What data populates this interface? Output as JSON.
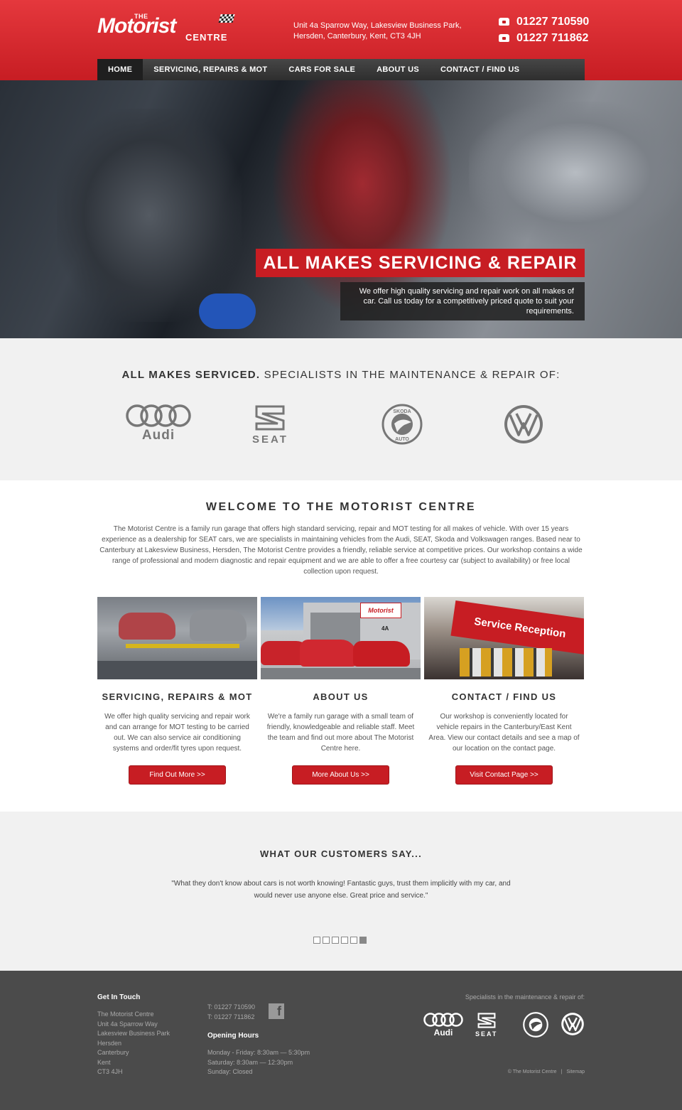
{
  "header": {
    "logo_the": "THE",
    "logo_main": "Motorist",
    "logo_centre": "CENTRE",
    "address_line1": "Unit 4a Sparrow Way, Lakesview Business Park,",
    "address_line2": "Hersden, Canterbury, Kent, CT3 4JH",
    "phone1": "01227 710590",
    "phone2": "01227 711862"
  },
  "nav": {
    "items": [
      "HOME",
      "SERVICING, REPAIRS & MOT",
      "CARS FOR SALE",
      "ABOUT US",
      "CONTACT / FIND US"
    ]
  },
  "hero": {
    "title": "ALL MAKES SERVICING & REPAIR",
    "text": "We offer high quality servicing and repair work on all makes of car. Call us today for a competitively priced quote to suit your requirements."
  },
  "brands": {
    "title_bold": "ALL MAKES SERVICED.",
    "title_rest": " SPECIALISTS IN THE MAINTENANCE & REPAIR OF:",
    "audi": "Audi",
    "seat": "SEAT",
    "skoda_top": "SKODA",
    "skoda_bottom": "AUTO"
  },
  "welcome": {
    "title": "WELCOME TO THE MOTORIST CENTRE",
    "text": "The Motorist Centre is a family run garage that offers high standard servicing, repair and MOT testing for all makes of vehicle. With over 15 years experience as a dealership for SEAT cars, we are specialists in maintaining vehicles from the Audi, SEAT, Skoda and Volkswagen ranges. Based near to Canterbury at Lakesview Business, Hersden, The Motorist Centre provides a friendly, reliable service at competitive prices. Our workshop contains a wide range of professional and modern diagnostic and repair equipment and we are able to offer a free courtesy car (subject to availability) or free local collection upon request."
  },
  "cards": [
    {
      "title": "SERVICING, REPAIRS & MOT",
      "text": "We offer high quality servicing and repair work and can arrange for MOT testing to be carried out. We can also service air conditioning systems and order/fit tyres upon request.",
      "button": "Find Out More >>"
    },
    {
      "title": "ABOUT US",
      "text": "We're a family run garage with a small team of friendly, knowledgeable and reliable staff. Meet the team and find out more about The Motorist Centre here.",
      "button": "More About Us >>",
      "sign": "Motorist",
      "unit": "4A"
    },
    {
      "title": "CONTACT / FIND US",
      "text": "Our workshop is conveniently located for vehicle repairs in the Canterbury/East Kent Area. View our contact details and see a map of our location on the contact page.",
      "button": "Visit Contact Page >>",
      "sign": "Service Reception"
    }
  ],
  "testimonials": {
    "title": "WHAT OUR CUSTOMERS SAY...",
    "quote": "\"What they don't know about cars is not worth knowing! Fantastic guys, trust them implicitly with my car, and would never use anyone else. Great price and service.\"",
    "active_index": 5
  },
  "footer": {
    "get_in_touch": "Get In Touch",
    "address": [
      "The Motorist Centre",
      "Unit 4a Sparrow Way",
      "Lakesview Business Park",
      "Hersden",
      "Canterbury",
      "Kent",
      "CT3 4JH"
    ],
    "tel1": "T: 01227 710590",
    "tel2": "T: 01227 711862",
    "opening_title": "Opening Hours",
    "hours": [
      "Monday - Friday: 8:30am — 5:30pm",
      "Saturday: 8:30am — 12:30pm",
      "Sunday: Closed"
    ],
    "specialists": "Specialists in the maintenance & repair of:",
    "copyright": "© The Motorist Centre",
    "separator": "|",
    "sitemap": "Sitemap",
    "facebook_letter": "f"
  },
  "colors": {
    "brand_red": "#c71d23",
    "footer_bg": "#4b4b4b",
    "light_bg": "#f1f1f1"
  }
}
